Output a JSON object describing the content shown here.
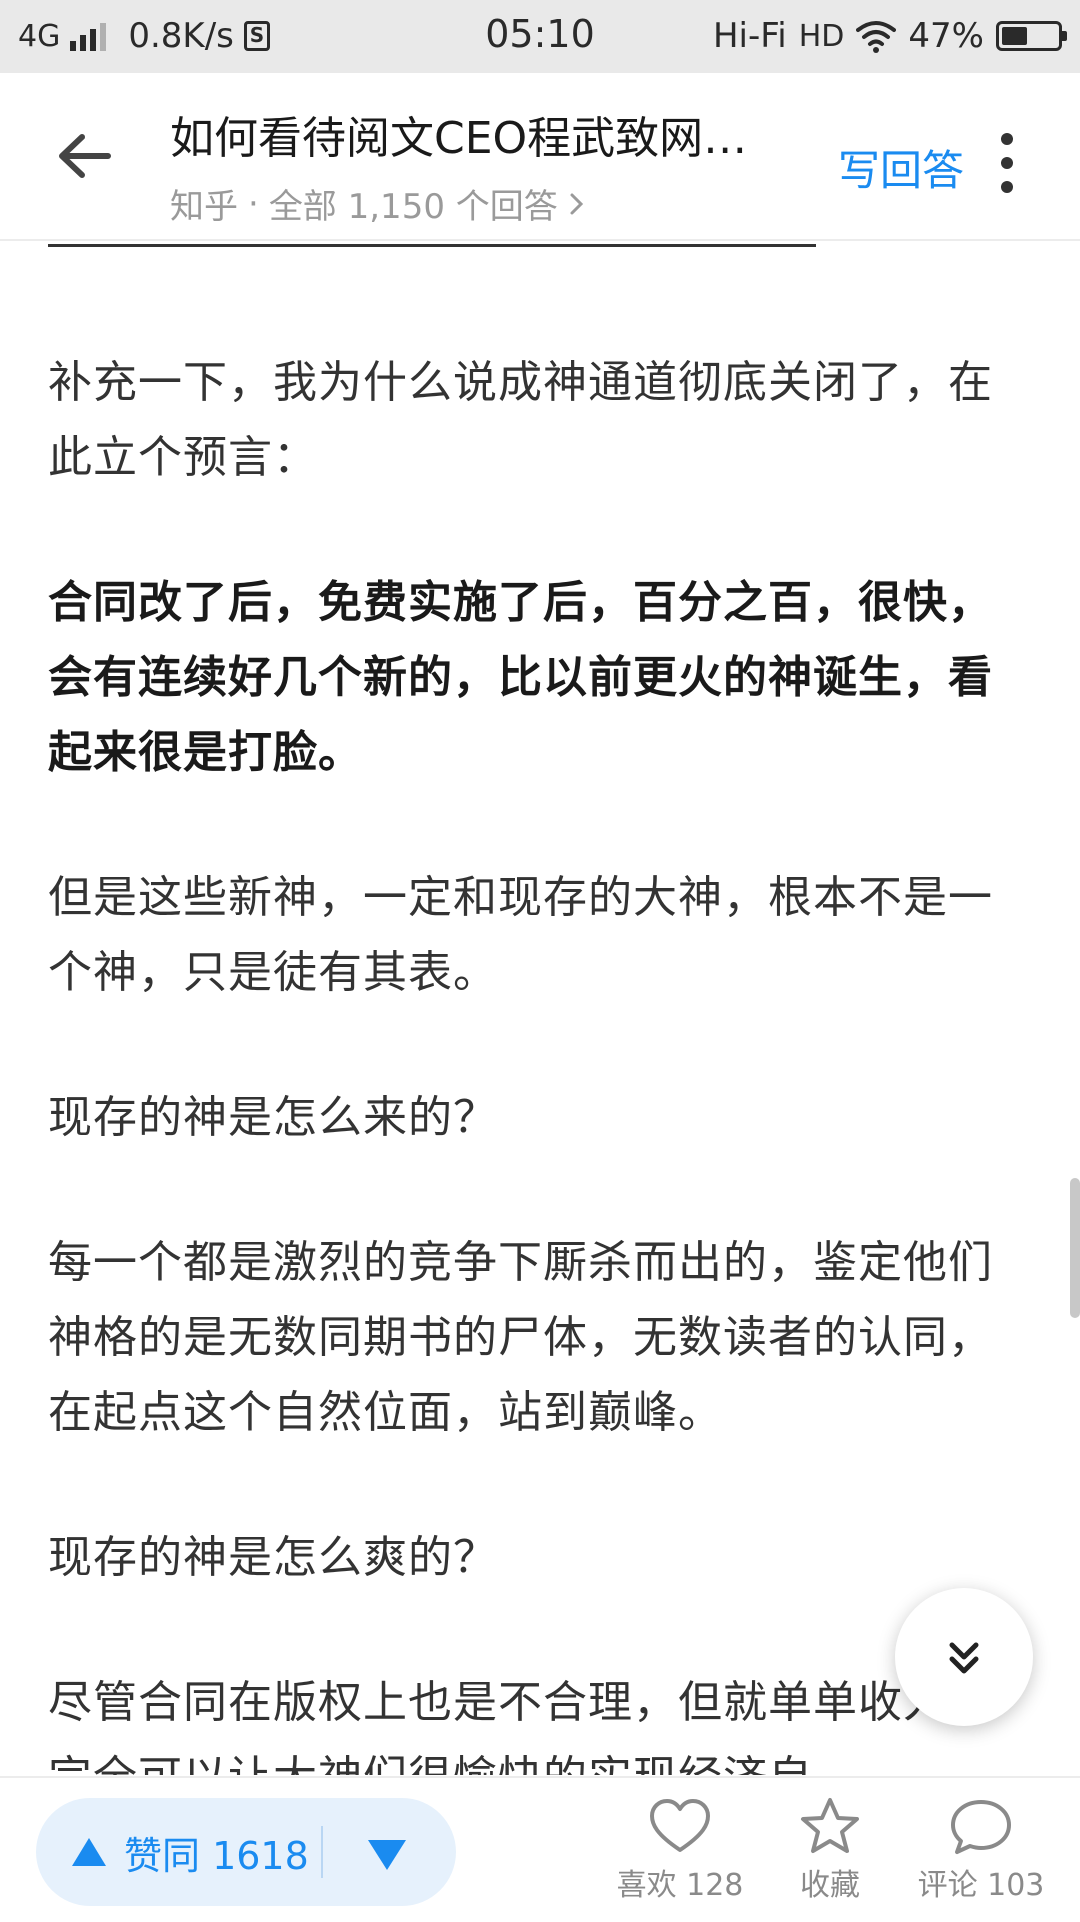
{
  "status_bar": {
    "network": "4G",
    "speed": "0.8K/s",
    "time": "05:10",
    "hifi": "Hi-Fi",
    "hd": "HD",
    "battery_percent": "47%",
    "battery_level": 0.47
  },
  "header": {
    "title": "如何看待阅文CEO程武致网…",
    "source": "知乎",
    "separator": "·",
    "answers_count": "全部 1,150 个回答",
    "write_answer_label": "写回答"
  },
  "content": {
    "paragraphs": [
      "补充一下，我为什么说成神通道彻底关闭了，在此立个预言：",
      "合同改了后，免费实施了后，百分之百，很快，会有连续好几个新的，比以前更火的神诞生，看起来很是打脸。",
      "但是这些新神，一定和现存的大神，根本不是一个神，只是徒有其表。",
      "现存的神是怎么来的？",
      "每一个都是激烈的竞争下厮杀而出的，鉴定他们神格的是无数同期书的尸体，无数读者的认同，在起点这个自然位面，站到巅峰。",
      "现存的神是怎么爽的？",
      "尽管合同在版权上也是不合理，但就单单收入，完全可以让大神们很愉快的实现经济自"
    ]
  },
  "bottom_bar": {
    "upvote_label": "赞同 1618",
    "like_label": "喜欢 128",
    "collect_label": "收藏",
    "comment_label": "评论 103"
  },
  "colors": {
    "accent": "#1a8bf0",
    "vote_bg": "#e6f1fc",
    "status_bg": "#e9e9e9"
  }
}
